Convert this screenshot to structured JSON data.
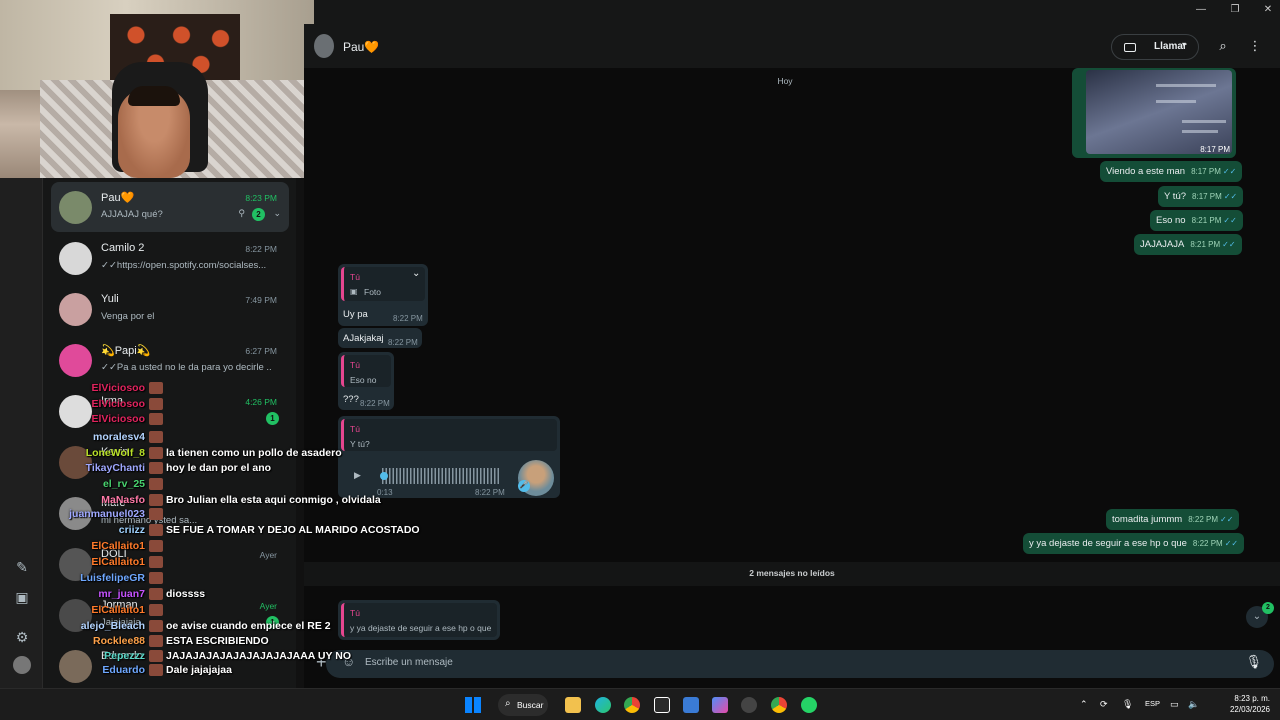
{
  "window": {
    "min": "—",
    "restore": "❐",
    "close": "✕"
  },
  "header": {
    "contact_name": "Pau🧡",
    "call_label": "Llamar"
  },
  "chats": [
    {
      "name": "Pau🧡",
      "last": "AJJAJAJ qué?",
      "time": "8:23 PM",
      "unread": "2",
      "active": true,
      "time_green": true
    },
    {
      "name": "Camilo 2",
      "last": "✓✓https://open.spotify.com/socialses...",
      "time": "8:22 PM"
    },
    {
      "name": "Yuli",
      "last": "Venga por el",
      "time": "7:49 PM"
    },
    {
      "name": "💫Papi💫",
      "last": "✓✓Pa a usted no le da para yo decirle ...",
      "time": "6:27 PM"
    },
    {
      "name": "Irma",
      "last": "",
      "time": "4:26 PM",
      "unread": "1",
      "time_green": true
    },
    {
      "name": "Kevin",
      "last": "",
      "time": ""
    },
    {
      "name": "Mafe",
      "last": "mi hermano ysted sa...",
      "time": ""
    },
    {
      "name": "DOLI",
      "last": "",
      "time": "Ayer"
    },
    {
      "name": "Jorman",
      "last": "Jajajajaja",
      "time": "Ayer",
      "unread": "1",
      "time_green": true
    },
    {
      "name": "Eduardo",
      "last": "",
      "time": ""
    }
  ],
  "messages": {
    "date_today": "Hoy",
    "image_time": "8:17 PM",
    "out": [
      {
        "text": "Viendo a este man",
        "time": "8:17 PM"
      },
      {
        "text": "Y tú?",
        "time": "8:17 PM"
      },
      {
        "text": "Eso no",
        "time": "8:21 PM"
      },
      {
        "text": "JAJAJAJA",
        "time": "8:21 PM"
      },
      {
        "text": "tomadita jummm",
        "time": "8:22 PM"
      },
      {
        "text": "y ya dejaste de seguir a ese hp o que",
        "time": "8:22 PM"
      }
    ],
    "in": [
      {
        "quote_who": "Tú",
        "quote_text": "Foto",
        "text": "Uy pa",
        "time": "8:22 PM"
      },
      {
        "text": "AJakjakaj",
        "time": "8:22 PM"
      },
      {
        "quote_who": "Tú",
        "quote_text": "Eso no",
        "text": "???",
        "time": "8:22 PM"
      },
      {
        "quote_who": "Tú",
        "quote_text": "Y tú?",
        "voice_duration": "0:13",
        "time": "8:22 PM"
      },
      {
        "quote_who": "Tú",
        "quote_text": "y ya dejaste de seguir a ese hp o que"
      }
    ],
    "unread_separator": "2 mensajes no leídos",
    "scroll_badge": "2"
  },
  "composer": {
    "placeholder": "Escribe un mensaje"
  },
  "twitch_chat": [
    {
      "user": "ElViciosoo",
      "color": "#e0245e",
      "msg": ""
    },
    {
      "user": "ElViciosoo",
      "color": "#e0245e",
      "msg": ""
    },
    {
      "user": "ElViciosoo",
      "color": "#e0245e",
      "msg": ""
    },
    {
      "user": "moralesv4",
      "color": "#b3d4ff",
      "msg": ""
    },
    {
      "user": "LoneWolf_8",
      "color": "#b9e128",
      "msg": "la tienen como un pollo de asadero"
    },
    {
      "user": "TikayChanti",
      "color": "#9fa8ff",
      "msg": "hoy le dan por el ano"
    },
    {
      "user": "el_rv_25",
      "color": "#49d36f",
      "msg": ""
    },
    {
      "user": "MaNasfo",
      "color": "#ff7aa8",
      "msg": "Bro Julian ella esta aqui conmigo , olvidala"
    },
    {
      "user": "juanmanuel023",
      "color": "#9fa8ff",
      "msg": ""
    },
    {
      "user": "criizz",
      "color": "#9fd2ff",
      "msg": "SE FUE A TOMAR Y DEJO AL MARIDO ACOSTADO"
    },
    {
      "user": "ElCallaito1",
      "color": "#ff7a2a",
      "msg": ""
    },
    {
      "user": "ElCallaito1",
      "color": "#ff7a2a",
      "msg": ""
    },
    {
      "user": "LuisfelipeGR",
      "color": "#6fa8ff",
      "msg": ""
    },
    {
      "user": "mr_juan7",
      "color": "#c653ff",
      "msg": "diossss"
    },
    {
      "user": "ElCallaito1",
      "color": "#ff7a2a",
      "msg": ""
    },
    {
      "user": "alejo_Bleach",
      "color": "#b3d4ff",
      "msg": "oe avise cuando empiece el RE 2"
    },
    {
      "user": "Rocklee88",
      "color": "#ffa24a",
      "msg": "ESTA ESCRIBIENDO"
    },
    {
      "user": "Pepezzz",
      "color": "#5ad8c8",
      "msg": "JAJAJAJAJAJAJAJAJAJAAA UY NO"
    },
    {
      "user": "Eduardo",
      "color": "#6fa8ff",
      "msg": "Dale jajajajaa"
    }
  ],
  "taskbar": {
    "search_label": "Buscar",
    "lang": "ESP",
    "time": "8:23 p. m.",
    "date": "22/03/2026"
  },
  "colors": {
    "accent": "#21c063",
    "out_bubble": "#144d37",
    "in_bubble": "#202c33",
    "quote_bar": "#e5468f"
  }
}
